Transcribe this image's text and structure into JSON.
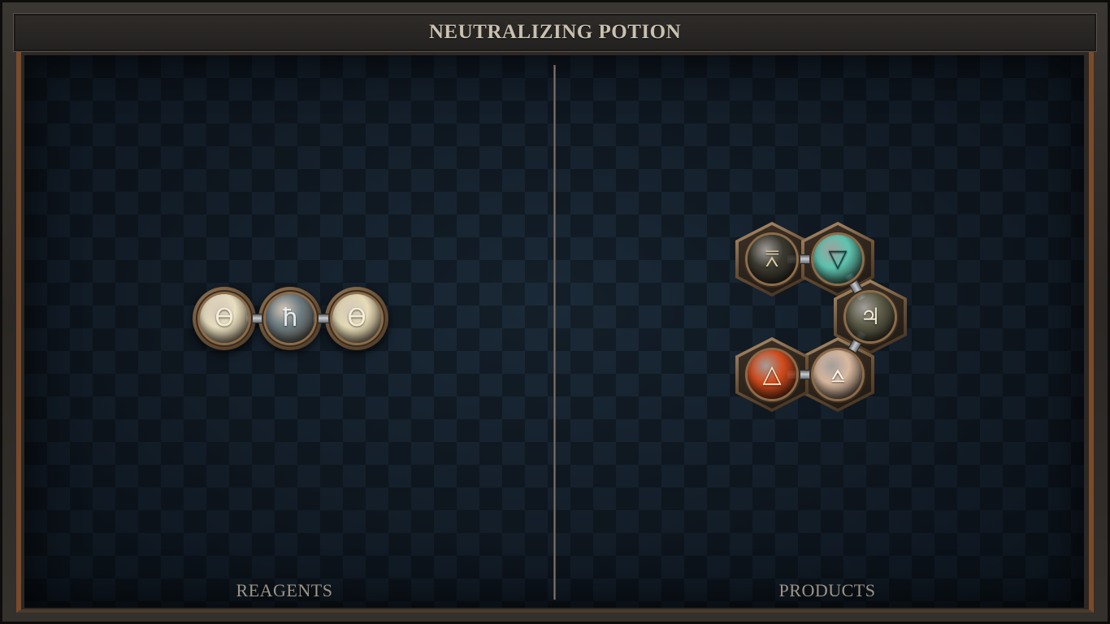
{
  "title": "NEUTRALIZING POTION",
  "labels": {
    "reagents": "REAGENTS",
    "products": "PRODUCTS"
  },
  "reagents": {
    "atoms": [
      {
        "name": "salt-atom-left",
        "symbol": "ϴ",
        "color": "#e8dfc0",
        "symbol_color": "#f4ecd6"
      },
      {
        "name": "lead-atom",
        "symbol": "ħ",
        "color": "#6d7c82",
        "symbol_color": "#e6ecef"
      },
      {
        "name": "salt-atom-right",
        "symbol": "ϴ",
        "color": "#e6dcb8",
        "symbol_color": "#f4ecd6"
      }
    ]
  },
  "products": {
    "atoms": [
      {
        "name": "vinegar-atom",
        "symbol": "⩞",
        "color": "#3b3a30",
        "symbol_color": "#d8c99a"
      },
      {
        "name": "water-atom",
        "symbol": "▽",
        "color": "#5ec4b0",
        "symbol_color": "#143c3a"
      },
      {
        "name": "tin-atom",
        "symbol": "♃",
        "color": "#5c5c48",
        "symbol_color": "#efe7cf"
      },
      {
        "name": "sulfur-atom",
        "symbol": "⩟",
        "color": "#d9b9a0",
        "symbol_color": "#fff7ef"
      },
      {
        "name": "fire-atom",
        "symbol": "△",
        "color": "#d24a1c",
        "symbol_color": "#ffe9c8"
      }
    ]
  },
  "colors": {
    "frame": "#2a2724",
    "board": "#121c26",
    "accent_copper": "#7a4a2a",
    "label_text": "#9c9487"
  }
}
